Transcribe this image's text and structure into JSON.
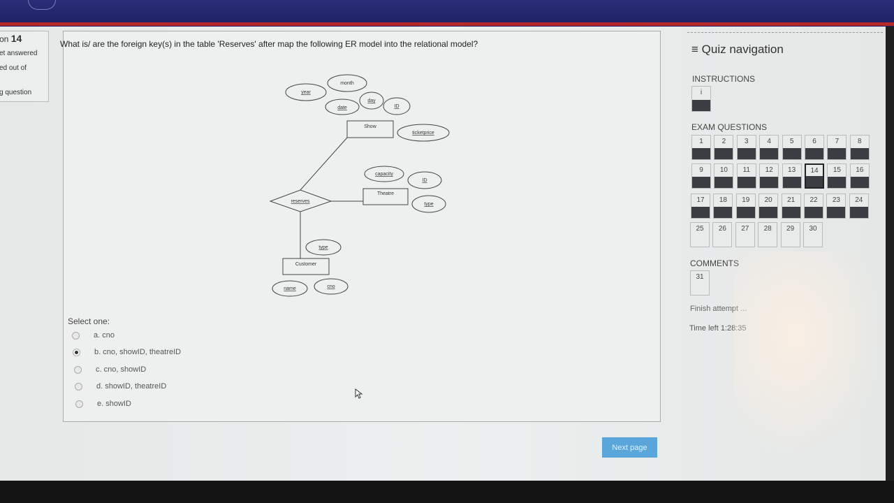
{
  "question_info": {
    "label": "on",
    "number": "14",
    "status1": "et answered",
    "status2": "ed out of",
    "flag": "g question"
  },
  "question": {
    "text": "What is/ are the foreign key(s) in the table 'Reserves' after map the following ER model into the relational model?",
    "select_label": "Select one:",
    "options": [
      {
        "label": "a. cno",
        "checked": false
      },
      {
        "label": "b. cno, showID, theatreID",
        "checked": true
      },
      {
        "label": "c. cno, showID",
        "checked": false
      },
      {
        "label": "d. showID, theatreID",
        "checked": false
      },
      {
        "label": "e. showID",
        "checked": false
      }
    ]
  },
  "diagram": {
    "entities": {
      "show": "Show",
      "theatre": "Theatre",
      "customer": "Customer"
    },
    "relationship": "reserves",
    "attributes": {
      "year": "year",
      "month": "month",
      "day": "day",
      "date": "date",
      "show_id": "ID",
      "ticketprice": "ticketprice",
      "capacity": "capacity",
      "theatre_id": "ID",
      "theatre_type": "type",
      "customer_type": "type",
      "name": "name",
      "cno": "cno"
    }
  },
  "next_button": "Next page",
  "nav": {
    "title": "Quiz navigation",
    "instructions_label": "INSTRUCTIONS",
    "instructions_item": "i",
    "exam_label": "EXAM QUESTIONS",
    "exam_items": [
      "1",
      "2",
      "3",
      "4",
      "5",
      "6",
      "7",
      "8",
      "9",
      "10",
      "11",
      "12",
      "13",
      "14",
      "15",
      "16",
      "17",
      "18",
      "19",
      "20",
      "21",
      "22",
      "23",
      "24",
      "25",
      "26",
      "27",
      "28",
      "29",
      "30"
    ],
    "current": "14",
    "comments_label": "COMMENTS",
    "comments_item": "31",
    "finish": "Finish attempt ...",
    "time_left": "Time left 1:28:35"
  },
  "colors": {
    "banner": "#22256a",
    "banner_stripe": "#b6262a",
    "next_button": "#5aa5da",
    "answered_fill": "#3a3e43"
  }
}
